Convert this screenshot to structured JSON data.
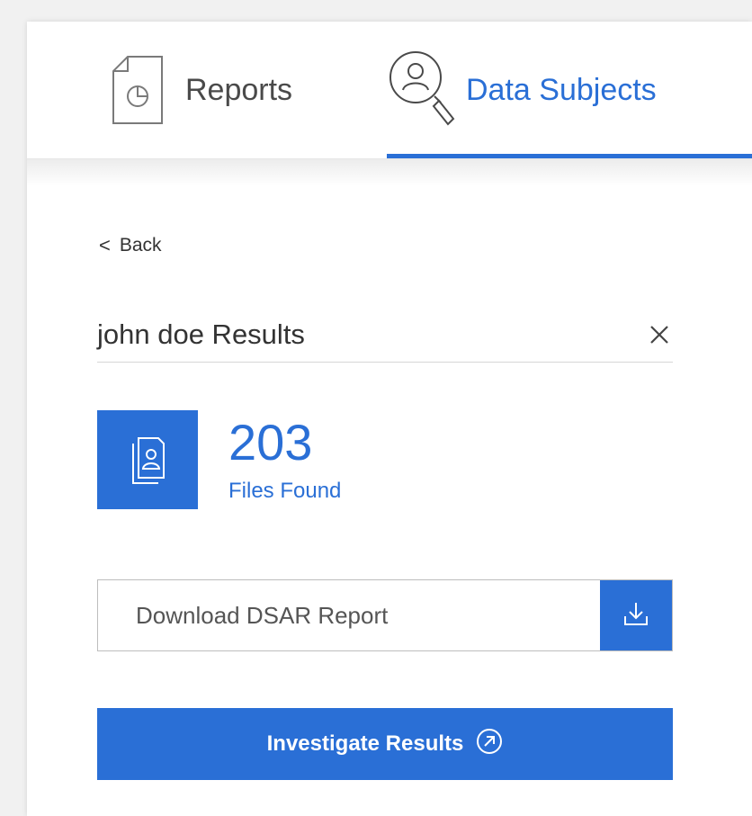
{
  "tabs": {
    "reports_label": "Reports",
    "subjects_label": "Data Subjects"
  },
  "back": {
    "chevron": "<",
    "label": "Back"
  },
  "results": {
    "title": "john doe Results"
  },
  "files": {
    "count": "203",
    "label": "Files Found"
  },
  "download": {
    "label": "Download DSAR Report"
  },
  "investigate": {
    "label": "Investigate Results"
  },
  "colors": {
    "accent": "#2a6fd6",
    "text": "#333333",
    "border": "#bdbdbd"
  },
  "icons": [
    "report-document-icon",
    "data-subject-search-icon",
    "close-icon",
    "person-files-icon",
    "download-icon",
    "arrow-up-right-icon"
  ]
}
